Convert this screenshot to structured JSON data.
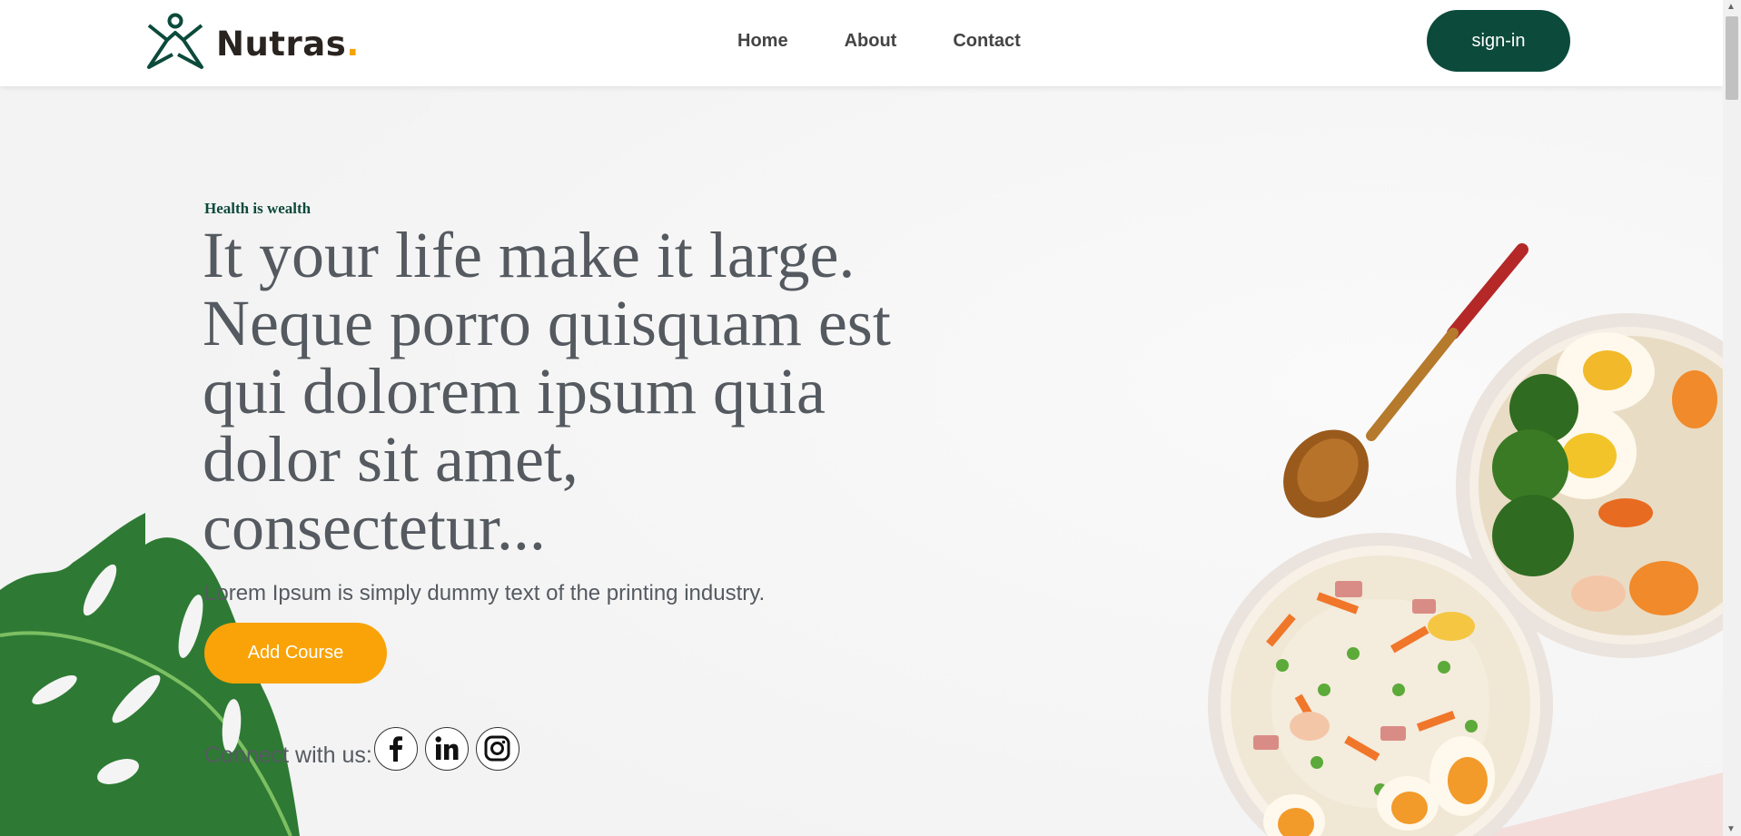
{
  "brand": {
    "name": "Nutras",
    "dot": "."
  },
  "nav": {
    "items": [
      "Home",
      "About",
      "Contact"
    ]
  },
  "signin_label": "sign-in",
  "hero": {
    "tagline": "Health is wealth",
    "headline": "It your life make it large. Neque porro quisquam est qui dolorem ipsum quia dolor sit amet, consectetur...",
    "subtext": "Lorem Ipsum is simply dummy text of the printing industry.",
    "cta_label": "Add Course",
    "connect_label": "Connect with us:"
  },
  "social": [
    "facebook-icon",
    "linkedin-icon",
    "instagram-icon"
  ],
  "colors": {
    "brand_green": "#0c4a3b",
    "accent_orange": "#f9a308",
    "text_gray": "#555a60"
  }
}
